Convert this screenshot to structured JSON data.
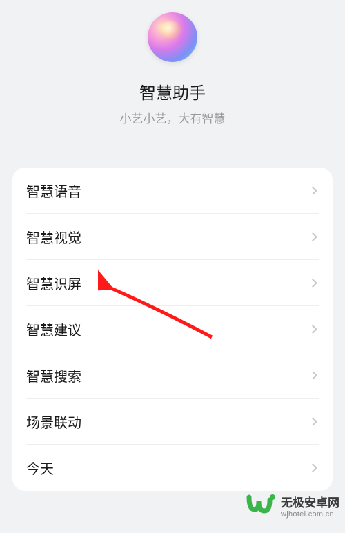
{
  "header": {
    "title": "智慧助手",
    "subtitle": "小艺小艺，大有智慧"
  },
  "menu": {
    "items": [
      {
        "label": "智慧语音"
      },
      {
        "label": "智慧视觉"
      },
      {
        "label": "智慧识屏"
      },
      {
        "label": "智慧建议"
      },
      {
        "label": "智慧搜索"
      },
      {
        "label": "场景联动"
      },
      {
        "label": "今天"
      }
    ]
  },
  "watermark": {
    "title": "无极安卓网",
    "url": "wjhotel.com.cn"
  }
}
